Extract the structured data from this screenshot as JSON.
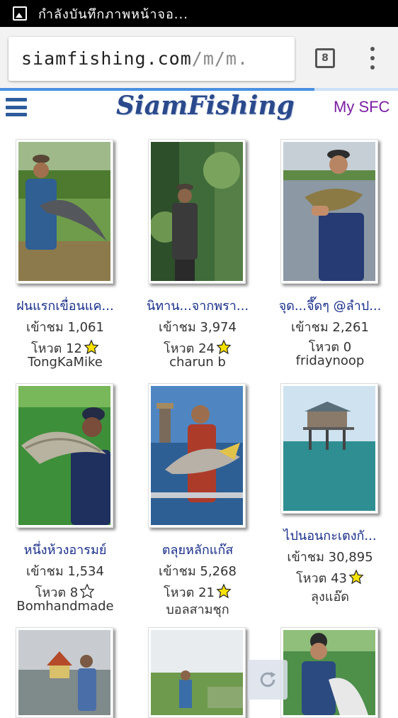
{
  "status_bar": {
    "notification_text": "กำลังบันทึกภาพหน้าจอ..."
  },
  "browser": {
    "url_host": "siamfishing.com",
    "url_path": "/m/m.",
    "tab_count": "8",
    "load_progress": 0.79
  },
  "site": {
    "logo_text": "SiamFishing",
    "my_link": "My SFC"
  },
  "posts": [
    {
      "title": "ฝนแรกเขื่อนแค...",
      "views": "เข้าชม 1,061",
      "votes": "โหวต 12",
      "starred": true,
      "author": "TongKaMike"
    },
    {
      "title": "นิทาน...จากพรา...",
      "views": "เข้าชม 3,974",
      "votes": "โหวต 24",
      "starred": true,
      "author": "charun b"
    },
    {
      "title": "จุด...จึ๊ดๆ @ลำป...",
      "views": "เข้าชม 2,261",
      "votes": "โหวต 0",
      "starred": false,
      "author": "fridaynoop"
    },
    {
      "title": "หนึ่งห้วงอารมย์",
      "views": "เข้าชม 1,534",
      "votes": "โหวต 8",
      "starred": false,
      "author": "Bomhandmade"
    },
    {
      "title": "ตลุยหลักแก๊ส",
      "views": "เข้าชม 5,268",
      "votes": "โหวต 21",
      "starred": true,
      "author": "บอลสามชุก"
    },
    {
      "title": "ไปนอนกะเตงกั...",
      "views": "เข้าชม 30,895",
      "votes": "โหวต 43",
      "starred": true,
      "author": "ลุงแอ๊ด"
    }
  ],
  "colors": {
    "title_link": "#1a2f8a",
    "my_link": "#7b1fa2",
    "logo": "#2b4a8c",
    "progress": "#4a90e2"
  }
}
